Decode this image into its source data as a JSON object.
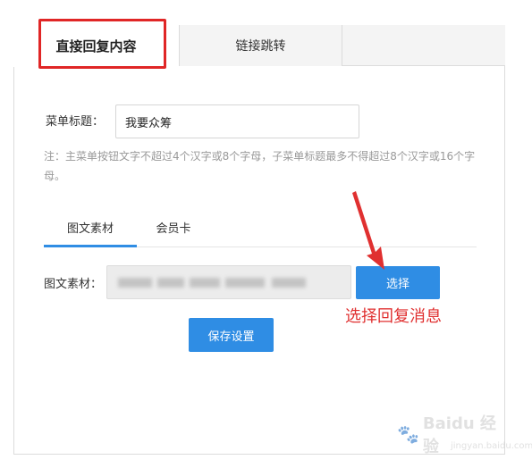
{
  "tabs": {
    "direct_reply": "直接回复内容",
    "link_jump": "链接跳转"
  },
  "menu": {
    "title_label": "菜单标题：",
    "title_value": "我要众筹",
    "note": "注：主菜单按钮文字不超过4个汉字或8个字母，子菜单标题最多不得超过8个汉字或16个字母。"
  },
  "subtabs": {
    "graphic_material": "图文素材",
    "member_card": "会员卡"
  },
  "material": {
    "label": "图文素材："
  },
  "buttons": {
    "select": "选择",
    "save": "保存设置"
  },
  "annotation": {
    "text": "选择回复消息",
    "color": "#e03030"
  },
  "watermark": {
    "text": "Baidu 经验",
    "sub": "jingyan.baidu.com"
  },
  "colors": {
    "accent": "#2f8de4",
    "highlight_box": "#e02626"
  }
}
